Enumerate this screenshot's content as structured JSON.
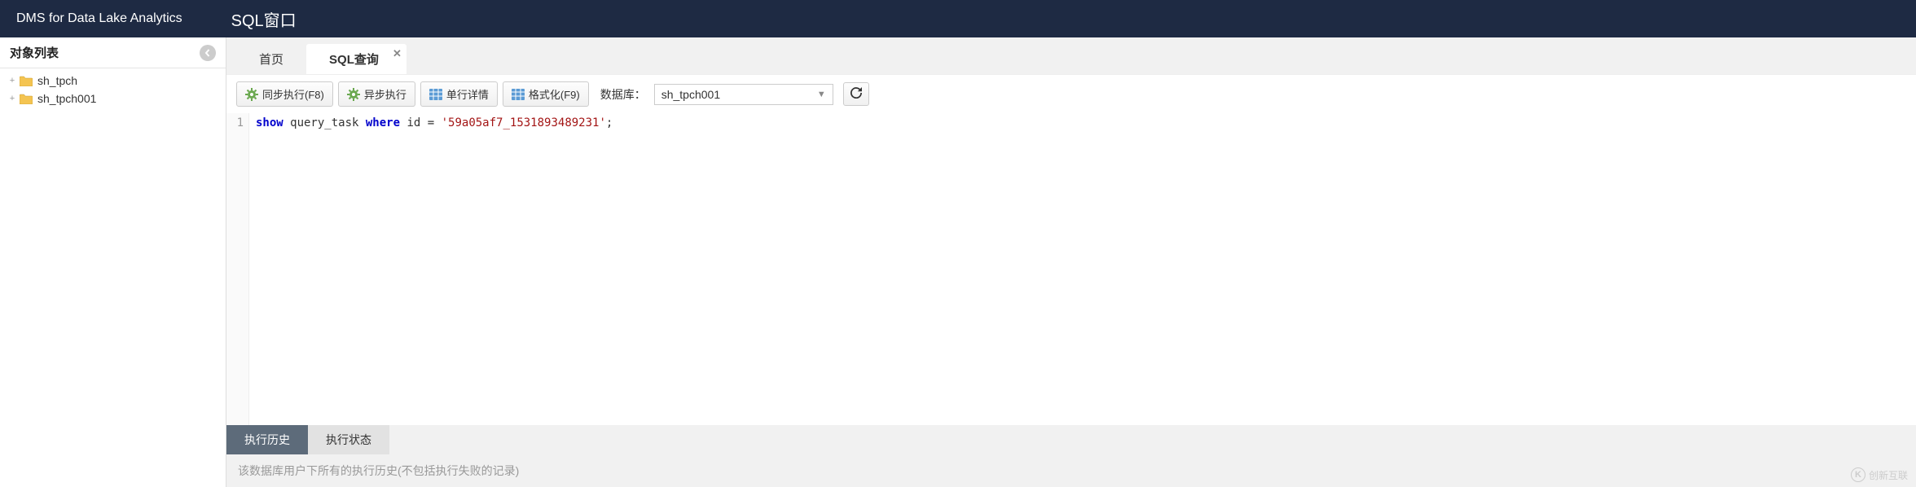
{
  "header": {
    "brand": "DMS for Data Lake Analytics",
    "title": "SQL窗口"
  },
  "sidebar": {
    "title": "对象列表",
    "items": [
      {
        "label": "sh_tpch"
      },
      {
        "label": "sh_tpch001"
      }
    ]
  },
  "tabs": [
    {
      "label": "首页",
      "active": false,
      "closable": false
    },
    {
      "label": "SQL查询",
      "active": true,
      "closable": true
    }
  ],
  "toolbar": {
    "sync_run": "同步执行(F8)",
    "async_run": "异步执行",
    "row_detail": "单行详情",
    "format": "格式化(F9)",
    "db_label": "数据库：",
    "db_value": "sh_tpch001"
  },
  "editor": {
    "line_number": "1",
    "tokens": {
      "kw1": "show",
      "t1": " query_task ",
      "kw2": "where",
      "t2": " id = ",
      "str1": "'59a05af7_1531893489231'",
      "t3": ";"
    }
  },
  "bottom_tabs": {
    "history": "执行历史",
    "status": "执行状态"
  },
  "status_text": "该数据库用户下所有的执行历史(不包括执行失败的记录)",
  "watermark": "创新互联"
}
